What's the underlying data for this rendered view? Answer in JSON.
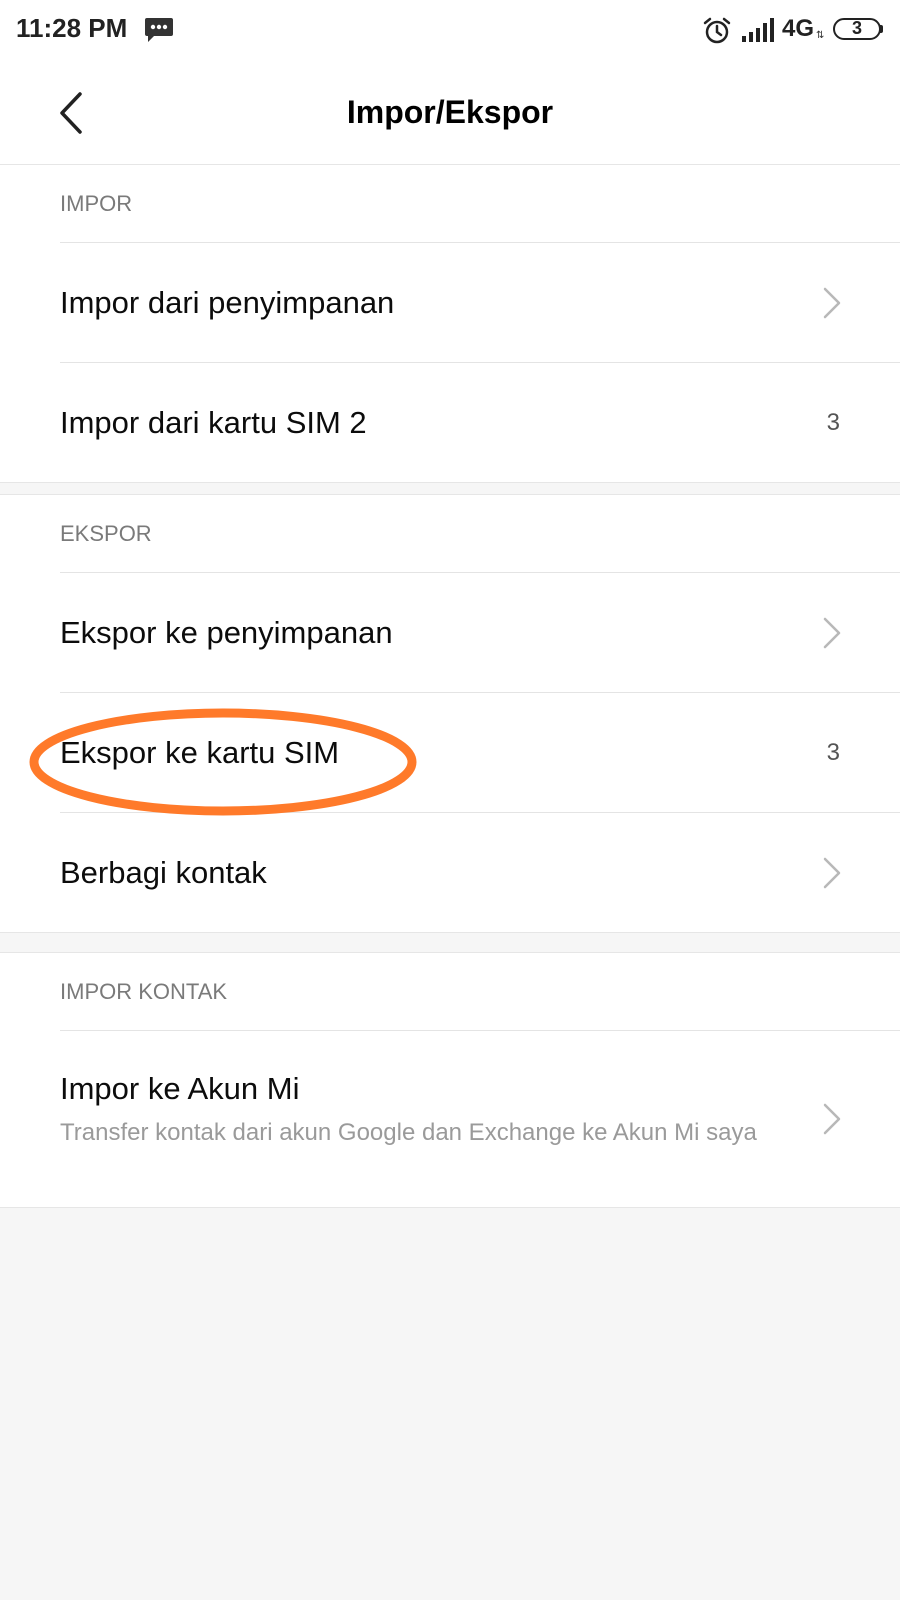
{
  "status_bar": {
    "time": "11:28 PM",
    "network": "4G",
    "battery": "3",
    "icons": [
      "message-icon",
      "alarm-icon",
      "signal-icon",
      "battery-icon"
    ]
  },
  "app_bar": {
    "title": "Impor/Ekspor",
    "back_icon": "chevron-left-icon"
  },
  "sections": {
    "impor": {
      "header": "IMPOR",
      "items": [
        {
          "label": "Impor dari penyimpanan",
          "trailing": "chevron-right-icon"
        },
        {
          "label": "Impor dari kartu SIM 2",
          "value": "3"
        }
      ]
    },
    "ekspor": {
      "header": "EKSPOR",
      "items": [
        {
          "label": "Ekspor ke penyimpanan",
          "trailing": "chevron-right-icon"
        },
        {
          "label": "Ekspor ke kartu SIM",
          "value": "3",
          "highlighted": true
        },
        {
          "label": "Berbagi kontak",
          "trailing": "chevron-right-icon"
        }
      ]
    },
    "impor_kontak": {
      "header": "IMPOR KONTAK",
      "items": [
        {
          "label": "Impor ke Akun Mi",
          "subtitle": "Transfer kontak dari akun Google dan Exchange ke Akun Mi saya",
          "trailing": "chevron-right-icon"
        }
      ]
    }
  },
  "colors": {
    "highlight": "#ff7a2a",
    "background": "#f6f6f6",
    "card": "#ffffff",
    "header_text": "#7a7a7a",
    "subtitle_text": "#9a9a9a"
  }
}
